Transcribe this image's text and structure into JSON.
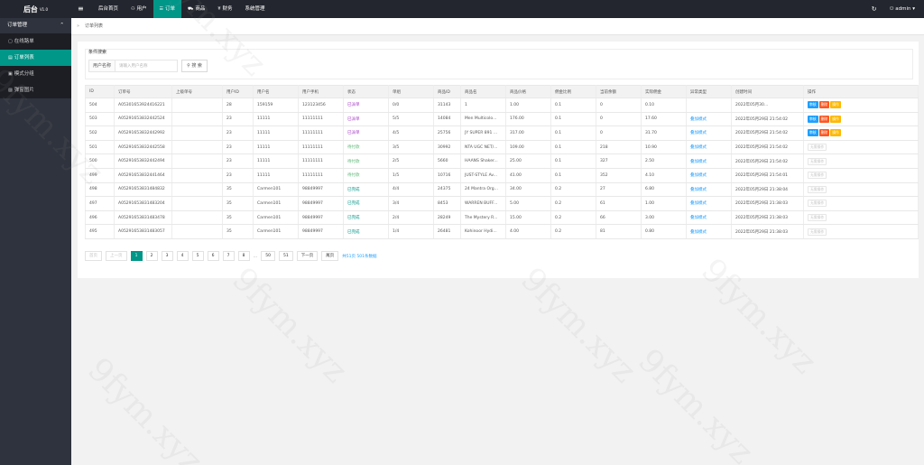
{
  "header": {
    "logo": "后台",
    "version": "V1.0",
    "menu_icon": "hamburger-icon",
    "nav": [
      {
        "label": "后台首页",
        "icon": ""
      },
      {
        "label": "用户",
        "icon": "user-icon"
      },
      {
        "label": "订单",
        "icon": "order-icon"
      },
      {
        "label": "商品",
        "icon": "cart-icon"
      },
      {
        "label": "财务",
        "icon": "money-icon"
      },
      {
        "label": "系统管理",
        "icon": ""
      }
    ],
    "active_nav": 2,
    "user": "admin"
  },
  "sidebar": {
    "group_label": "订单管理",
    "items": [
      {
        "label": "在线路单",
        "icon": "document-icon"
      },
      {
        "label": "订单列表",
        "icon": "list-icon"
      },
      {
        "label": "模式分组",
        "icon": "group-icon"
      },
      {
        "label": "弹窗图片",
        "icon": "image-icon"
      }
    ],
    "active_item": 1
  },
  "tabs": {
    "current": "订单列表"
  },
  "filter": {
    "legend": "条件搜索",
    "label": "用户名称",
    "placeholder": "请输入用户名称",
    "button": "搜 索"
  },
  "table": {
    "headers": [
      "ID",
      "订单号",
      "上级单号",
      "用户ID",
      "用户名",
      "用户手机",
      "状态",
      "单组",
      "商品ID",
      "商品名",
      "商品价格",
      "佣金比例",
      "当前余额",
      "实际佣金",
      "异常类型",
      "创建时间",
      "操作"
    ],
    "rows": [
      {
        "id": "504",
        "order_no": "A05301653924416221",
        "parent": "",
        "uid": "28",
        "uname": "159159",
        "phone": "123123456",
        "status": "已派单",
        "st": "pending",
        "group": "0/0",
        "gid": "31143",
        "gname": "1",
        "price": "1.00",
        "rate": "0.1",
        "balance": "0",
        "commission": "0.10",
        "etype": "",
        "time": "2022年05月30...",
        "actions": "three"
      },
      {
        "id": "503",
        "order_no": "A05291653832442524",
        "parent": "",
        "uid": "23",
        "uname": "11111",
        "phone": "11111111",
        "status": "已派单",
        "st": "pending",
        "group": "5/5",
        "gid": "14084",
        "gname": "Men Multicolo...",
        "price": "176.00",
        "rate": "0.1",
        "balance": "0",
        "commission": "17.60",
        "etype": "叠加模式",
        "time": "2022年05月29日 21:54:02",
        "actions": "three"
      },
      {
        "id": "502",
        "order_no": "A05291653832442992",
        "parent": "",
        "uid": "23",
        "uname": "11111",
        "phone": "11111111",
        "status": "已派单",
        "st": "pending",
        "group": "4/5",
        "gid": "25756",
        "gname": "JY SUPER 891 ...",
        "price": "317.00",
        "rate": "0.1",
        "balance": "0",
        "commission": "31.70",
        "etype": "叠加模式",
        "time": "2022年05月29日 21:54:02",
        "actions": "three"
      },
      {
        "id": "501",
        "order_no": "A05291653832442558",
        "parent": "",
        "uid": "23",
        "uname": "11111",
        "phone": "11111111",
        "status": "待付款",
        "st": "wait",
        "group": "3/5",
        "gid": "30992",
        "gname": "NTA UGC NET/...",
        "price": "109.00",
        "rate": "0.1",
        "balance": "218",
        "commission": "10.90",
        "etype": "叠加模式",
        "time": "2022年05月29日 21:54:02",
        "actions": "none"
      },
      {
        "id": "500",
        "order_no": "A05291653832442494",
        "parent": "",
        "uid": "23",
        "uname": "11111",
        "phone": "11111111",
        "status": "待付款",
        "st": "wait",
        "group": "2/5",
        "gid": "5660",
        "gname": "HAANS Shaker...",
        "price": "25.00",
        "rate": "0.1",
        "balance": "327",
        "commission": "2.50",
        "etype": "叠加模式",
        "time": "2022年05月29日 21:54:02",
        "actions": "none"
      },
      {
        "id": "499",
        "order_no": "A05291653832441464",
        "parent": "",
        "uid": "23",
        "uname": "11111",
        "phone": "11111111",
        "status": "待付款",
        "st": "wait",
        "group": "1/5",
        "gid": "10716",
        "gname": "JUST-STYLE Av...",
        "price": "41.00",
        "rate": "0.1",
        "balance": "352",
        "commission": "4.10",
        "etype": "叠加模式",
        "time": "2022年05月29日 21:54:01",
        "actions": "none"
      },
      {
        "id": "498",
        "order_no": "A05291653831484832",
        "parent": "",
        "uid": "35",
        "uname": "Carmen101",
        "phone": "98849997",
        "status": "已完成",
        "st": "done",
        "group": "4/4",
        "gid": "24375",
        "gname": "24 Mantra Org...",
        "price": "34.00",
        "rate": "0.2",
        "balance": "27",
        "commission": "6.80",
        "etype": "叠加模式",
        "time": "2022年05月29日 21:38:04",
        "actions": "none"
      },
      {
        "id": "497",
        "order_no": "A05291653831483204",
        "parent": "",
        "uid": "35",
        "uname": "Carmen101",
        "phone": "98849997",
        "status": "已完成",
        "st": "done",
        "group": "3/4",
        "gid": "8453",
        "gname": "WARREN BUFF...",
        "price": "5.00",
        "rate": "0.2",
        "balance": "61",
        "commission": "1.00",
        "etype": "叠加模式",
        "time": "2022年05月29日 21:38:03",
        "actions": "none"
      },
      {
        "id": "496",
        "order_no": "A05291653831483478",
        "parent": "",
        "uid": "35",
        "uname": "Carmen101",
        "phone": "98849997",
        "status": "已完成",
        "st": "done",
        "group": "2/4",
        "gid": "28249",
        "gname": "The Mystery R...",
        "price": "15.00",
        "rate": "0.2",
        "balance": "66",
        "commission": "3.00",
        "etype": "叠加模式",
        "time": "2022年05月29日 21:38:03",
        "actions": "none"
      },
      {
        "id": "495",
        "order_no": "A05291653831483057",
        "parent": "",
        "uid": "35",
        "uname": "Carmen101",
        "phone": "98849997",
        "status": "已完成",
        "st": "done",
        "group": "1/4",
        "gid": "26481",
        "gname": "Kohinoor Hydi...",
        "price": "4.00",
        "rate": "0.2",
        "balance": "81",
        "commission": "0.80",
        "etype": "叠加模式",
        "time": "2022年05月29日 21:38:03",
        "actions": "none"
      }
    ],
    "action_labels": {
      "a": "审核",
      "b": "删除",
      "c": "操作",
      "none": "无需操作"
    }
  },
  "pagination": {
    "first": "首页",
    "prev": "上一页",
    "pages": [
      "1",
      "2",
      "3",
      "4",
      "5",
      "6",
      "7",
      "8"
    ],
    "ellipsis": "...",
    "tail": [
      "50",
      "51"
    ],
    "next": "下一页",
    "last": "尾页",
    "total": "共51页 501条数据",
    "current": "1"
  },
  "watermark": "9fym.xyz",
  "colors": {
    "accent": "#009688",
    "header": "#23262e",
    "sidebar": "#2f333d",
    "blue": "#1e9fff",
    "red": "#ff5722",
    "orange": "#ffb800"
  }
}
